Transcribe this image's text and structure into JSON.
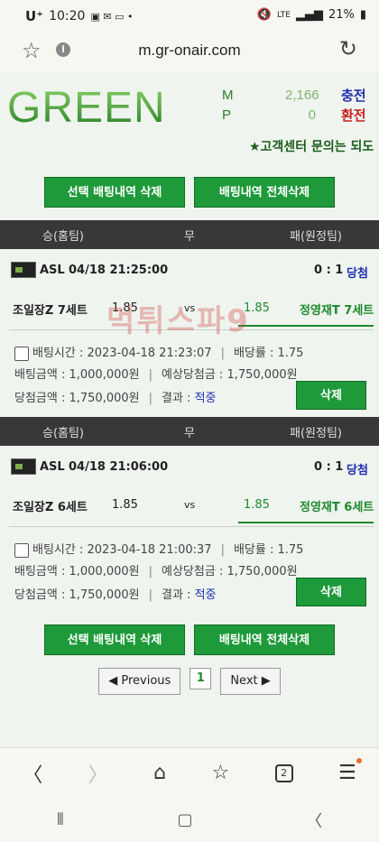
{
  "status": {
    "carrier": "U⁺",
    "time": "10:20",
    "battery": "21%",
    "network": "LTE"
  },
  "browser": {
    "url": "m.gr-onair.com"
  },
  "header": {
    "logo": "GREEN",
    "m_label": "M",
    "m_value": "2,166",
    "m_action": "충전",
    "p_label": "P",
    "p_value": "0",
    "p_action": "환전",
    "marquee": "★고객센터 문의는 되도"
  },
  "actions": {
    "delete_selected": "선택 배팅내역 삭제",
    "delete_all": "배팅내역 전체삭제"
  },
  "table_header": {
    "home": "승(홈팀)",
    "draw": "무",
    "away": "패(원정팀)"
  },
  "bets": [
    {
      "league": "ASL",
      "date": "04/18 21:25:00",
      "score": "0 : 1",
      "result": "당첨",
      "home": "조일장Z 7세트",
      "home_odds": "1.85",
      "vs": "vs",
      "away_odds": "1.85",
      "away": "정영재T 7세트",
      "bet_time_label": "배팅시간 : 2023-04-18 21:23:07",
      "odds_label": "배당률 : 1.75",
      "amount_label": "배팅금액 : 1,000,000원",
      "expected_label": "예상당첨금 : 1,750,000원",
      "win_label": "당첨금액 : 1,750,000원",
      "outcome_label": "결과 : ",
      "outcome": "적중",
      "delete": "삭제"
    },
    {
      "league": "ASL",
      "date": "04/18 21:06:00",
      "score": "0 : 1",
      "result": "당첨",
      "home": "조일장Z 6세트",
      "home_odds": "1.85",
      "vs": "vs",
      "away_odds": "1.85",
      "away": "정영재T 6세트",
      "bet_time_label": "배팅시간 : 2023-04-18 21:00:37",
      "odds_label": "배당률 : 1.75",
      "amount_label": "배팅금액 : 1,000,000원",
      "expected_label": "예상당첨금 : 1,750,000원",
      "win_label": "당첨금액 : 1,750,000원",
      "outcome_label": "결과 : ",
      "outcome": "적중",
      "delete": "삭제"
    }
  ],
  "watermark": "먹튀스파9",
  "pager": {
    "prev": "◀ Previous",
    "current": "1",
    "next": "Next ▶"
  },
  "nav": {
    "tabs_count": "2"
  }
}
